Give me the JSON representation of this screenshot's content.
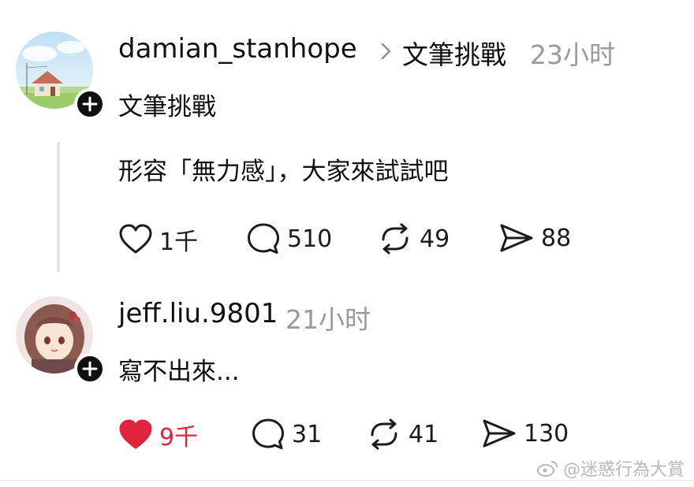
{
  "post1": {
    "username": "damian_stanhope",
    "topic": "文筆挑戰",
    "timestamp": "23小时",
    "topic_line": "文筆挑戰",
    "body": "形容「無力感」，大家來試試吧",
    "actions": {
      "likes": "1千",
      "comments": "510",
      "reposts": "49",
      "shares": "88"
    }
  },
  "post2": {
    "username": "jeff.liu.9801",
    "timestamp": "21小时",
    "body": "寫不出來...",
    "actions": {
      "likes": "9千",
      "comments": "31",
      "reposts": "41",
      "shares": "130"
    },
    "liked": true
  },
  "watermark": "@迷惑行為大賞",
  "colors": {
    "like_active": "#e0243b",
    "muted_text": "#9a9a9a",
    "thread_line": "#e3e3e3"
  },
  "icons": [
    "heart-icon",
    "comment-icon",
    "repost-icon",
    "share-icon",
    "plus-icon",
    "chevron-right-icon"
  ]
}
